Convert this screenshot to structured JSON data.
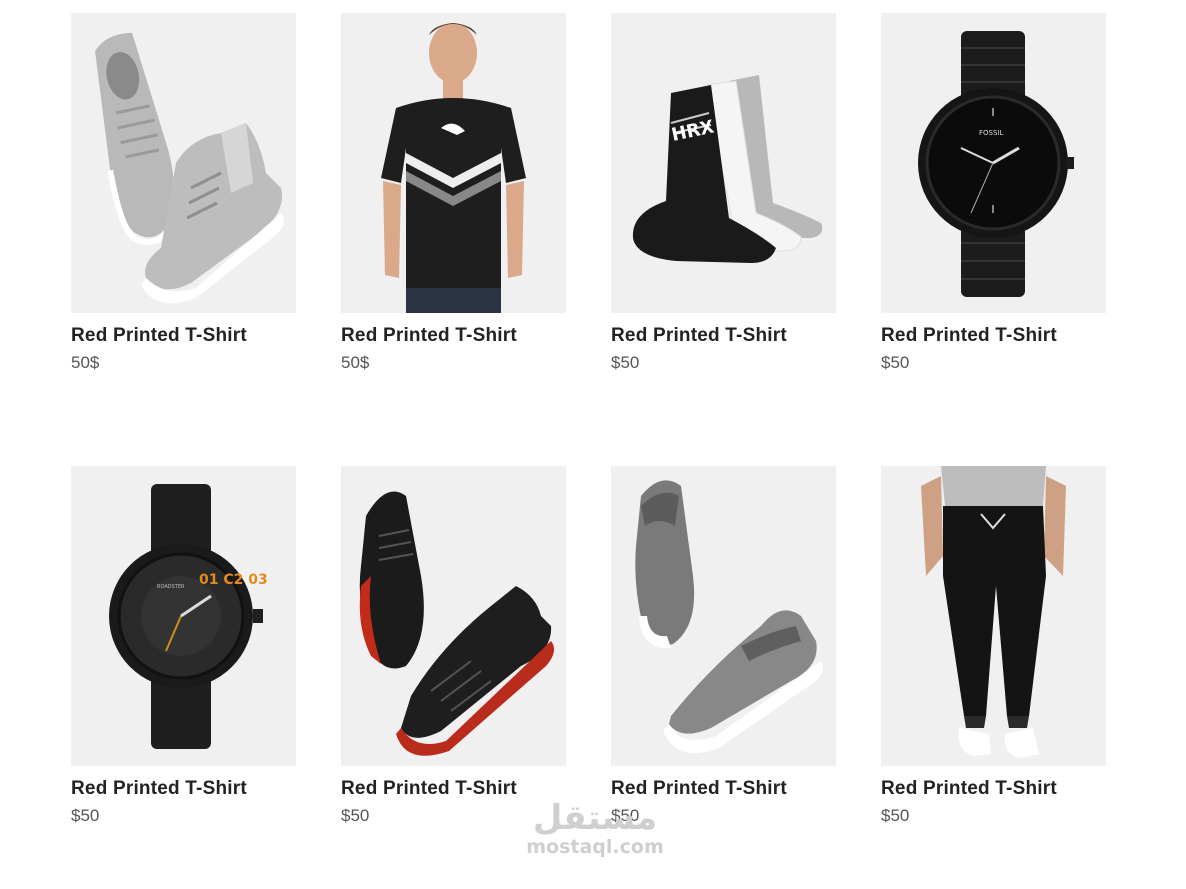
{
  "products": [
    {
      "name": "Red Printed T-Shirt",
      "price": "50$",
      "image": "grey-sneakers-icon"
    },
    {
      "name": "Red Printed T-Shirt",
      "price": "50$",
      "image": "black-tshirt-icon"
    },
    {
      "name": "Red Printed T-Shirt",
      "price": "$50",
      "image": "socks-icon"
    },
    {
      "name": "Red Printed T-Shirt",
      "price": "$50",
      "image": "black-watch-icon"
    },
    {
      "name": "Red Printed T-Shirt",
      "price": "$50",
      "image": "leather-watch-icon"
    },
    {
      "name": "Red Printed T-Shirt",
      "price": "$50",
      "image": "black-red-sneakers-icon"
    },
    {
      "name": "Red Printed T-Shirt",
      "price": "$50",
      "image": "grey-slipon-icon"
    },
    {
      "name": "Red Printed T-Shirt",
      "price": "$50",
      "image": "joggers-icon"
    }
  ],
  "watermark": {
    "arabic": "مستقل",
    "latin": "mostaql.com"
  },
  "colors": {
    "thumb_bg": "#f0f0f0",
    "title": "#222222",
    "price": "#555555"
  }
}
